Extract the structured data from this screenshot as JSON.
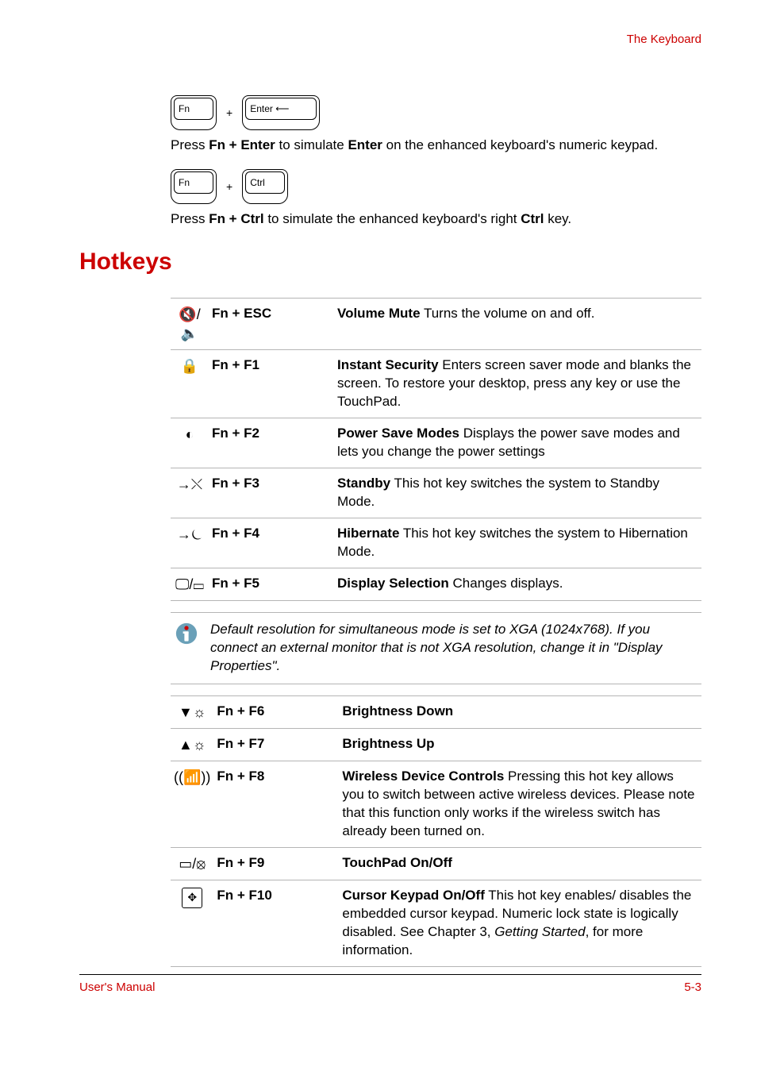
{
  "header": {
    "right": "The Keyboard"
  },
  "intro": {
    "keys": [
      {
        "k1": "Fn",
        "k2": "Enter ⟵",
        "wide": true
      },
      {
        "k1": "Fn",
        "k2": "Ctrl",
        "wide": false
      }
    ],
    "plus": "+",
    "p1_pre": "Press ",
    "p1_b1": "Fn + Enter",
    "p1_mid": " to simulate ",
    "p1_b2": "Enter",
    "p1_post": " on the enhanced keyboard's numeric keypad.",
    "p2_pre": "Press ",
    "p2_b1": "Fn + Ctrl",
    "p2_mid": " to simulate the enhanced keyboard's right ",
    "p2_b2": "Ctrl",
    "p2_post": " key."
  },
  "hotkeys_heading": "Hotkeys",
  "rows1": [
    {
      "icon": "speaker-mute-icon",
      "glyph": "🔇/🔈",
      "key": "Fn + ESC",
      "title": "Volume Mute",
      "desc": "   Turns the volume on and off."
    },
    {
      "icon": "lock-icon",
      "glyph": "🔒",
      "key": "Fn + F1",
      "title": "Instant Security",
      "desc": "   Enters screen saver mode and blanks the screen. To restore your desktop, press any key or use the TouchPad."
    },
    {
      "icon": "power-save-icon",
      "glyph": "◐",
      "key": "Fn + F2",
      "title": "Power Save Modes",
      "desc": "   Displays the power save modes and lets you change the power settings"
    },
    {
      "icon": "standby-icon",
      "glyph": "→⤬",
      "key": "Fn + F3",
      "title": "Standby",
      "desc": "   This hot key switches the system to Standby Mode."
    },
    {
      "icon": "hibernate-icon",
      "glyph": "→⏾",
      "key": "Fn + F4",
      "title": "Hibernate",
      "desc": "   This hot key switches the system to Hibernation Mode."
    },
    {
      "icon": "display-select-icon",
      "glyph": "🖵/▭",
      "key": "Fn + F5",
      "title": "Display Selection",
      "desc": "   Changes displays."
    }
  ],
  "note": {
    "text": "Default resolution for simultaneous mode is set to XGA (1024x768). If you connect an external monitor that is not XGA resolution, change it in \"Display Properties\"."
  },
  "rows2": [
    {
      "icon": "brightness-down-icon",
      "glyph": "▼☼",
      "key": "Fn + F6",
      "title": "Brightness Down",
      "desc": ""
    },
    {
      "icon": "brightness-up-icon",
      "glyph": "▲☼",
      "key": "Fn + F7",
      "title": "Brightness Up",
      "desc": ""
    },
    {
      "icon": "wireless-icon",
      "glyph": "((📶))",
      "key": "Fn + F8",
      "title": "Wireless Device Controls",
      "desc": "   Pressing this hot key allows you to switch between active wireless devices. Please note that this function only works if the wireless switch has already been turned on."
    },
    {
      "icon": "touchpad-icon",
      "glyph": "▭/⦻",
      "key": "Fn + F9",
      "title": "TouchPad On/Off",
      "desc": ""
    },
    {
      "icon": "cursor-keypad-icon",
      "glyph": "✥",
      "boxed": true,
      "key": "Fn + F10",
      "title": "Cursor Keypad On/Off",
      "desc_pre": "   This hot key enables/ disables the embedded cursor keypad. Numeric lock state is logically disabled. See Chapter 3, ",
      "desc_italic": "Getting Started",
      "desc_post": ", for more information."
    }
  ],
  "footer": {
    "left": "User's Manual",
    "right": "5-3"
  }
}
